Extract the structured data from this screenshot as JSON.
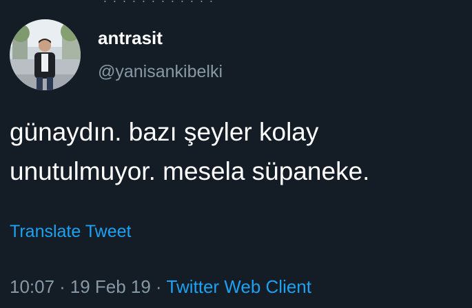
{
  "tweet": {
    "display_name": "antrasit",
    "handle": "@yanisankibelki",
    "text": "günaydın. bazı şeyler kolay unutulmuyor. mesela süpaneke.",
    "translate_label": "Translate Tweet",
    "time": "10:07",
    "separator": "·",
    "date": "19 Feb 19",
    "client": "Twitter Web Client"
  },
  "colors": {
    "background": "#141d26",
    "primary_text": "#ffffff",
    "secondary_text": "#8899a6",
    "link": "#1da1f2"
  }
}
